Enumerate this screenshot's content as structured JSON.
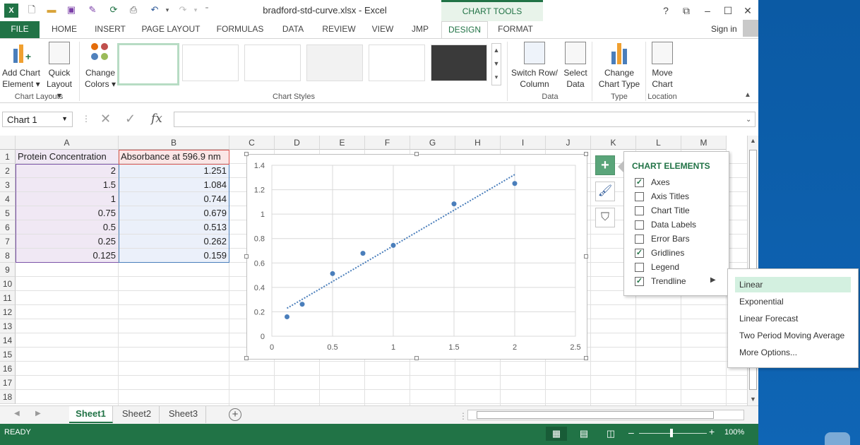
{
  "window": {
    "title": "bradford-std-curve.xlsx - Excel",
    "chart_tools": "CHART TOOLS",
    "help": "?",
    "sign_in": "Sign in"
  },
  "tabs": [
    "FILE",
    "HOME",
    "INSERT",
    "PAGE LAYOUT",
    "FORMULAS",
    "DATA",
    "REVIEW",
    "VIEW",
    "JMP",
    "DESIGN",
    "FORMAT"
  ],
  "ribbon": {
    "add_chart_1": "Add Chart",
    "add_chart_2": "Element ▾",
    "quick_layout_1": "Quick",
    "quick_layout_2": "Layout ▾",
    "change_colors_1": "Change",
    "change_colors_2": "Colors ▾",
    "switch_1": "Switch Row/",
    "switch_2": "Column",
    "select_1": "Select",
    "select_2": "Data",
    "change_type_1": "Change",
    "change_type_2": "Chart Type",
    "move_1": "Move",
    "move_2": "Chart",
    "groups": {
      "layouts": "Chart Layouts",
      "styles": "Chart Styles",
      "data": "Data",
      "type": "Type",
      "location": "Location"
    }
  },
  "formula_bar": {
    "name_box": "Chart 1",
    "fx": "fx",
    "value": ""
  },
  "columns": [
    "A",
    "B",
    "C",
    "D",
    "E",
    "F",
    "G",
    "H",
    "I",
    "J",
    "K",
    "L",
    "M"
  ],
  "rows": [
    "1",
    "2",
    "3",
    "4",
    "5",
    "6",
    "7",
    "8",
    "9",
    "10",
    "11",
    "12",
    "13",
    "14",
    "15",
    "16",
    "17",
    "18"
  ],
  "sheet": {
    "header_a": "Protein Concentration",
    "header_b": "Absorbance at 596.9 nm",
    "col_a": [
      "2",
      "1.5",
      "1",
      "0.75",
      "0.5",
      "0.25",
      "0.125"
    ],
    "col_b": [
      "1.251",
      "1.084",
      "0.744",
      "0.679",
      "0.513",
      "0.262",
      "0.159"
    ]
  },
  "chart_data": {
    "type": "scatter",
    "x": [
      2,
      1.5,
      1,
      0.75,
      0.5,
      0.25,
      0.125
    ],
    "y": [
      1.251,
      1.084,
      0.744,
      0.679,
      0.513,
      0.262,
      0.159
    ],
    "xlim": [
      0,
      2.5
    ],
    "ylim": [
      0,
      1.4
    ],
    "xticks": [
      "0",
      "0.5",
      "1",
      "1.5",
      "2",
      "2.5"
    ],
    "yticks": [
      "0",
      "0.2",
      "0.4",
      "0.6",
      "0.8",
      "1",
      "1.2",
      "1.4"
    ],
    "grid": true,
    "trendline": "linear",
    "trend_x": [
      0.125,
      2
    ],
    "trend_y": [
      0.229,
      1.324
    ],
    "marker_color": "#4a7ebb",
    "title": "",
    "xlabel": "",
    "ylabel": ""
  },
  "chart_elements": {
    "header": "CHART ELEMENTS",
    "items": [
      {
        "label": "Axes",
        "checked": true
      },
      {
        "label": "Axis Titles",
        "checked": false
      },
      {
        "label": "Chart Title",
        "checked": false
      },
      {
        "label": "Data Labels",
        "checked": false
      },
      {
        "label": "Error Bars",
        "checked": false
      },
      {
        "label": "Gridlines",
        "checked": true
      },
      {
        "label": "Legend",
        "checked": false
      },
      {
        "label": "Trendline",
        "checked": true
      }
    ]
  },
  "trendline_menu": [
    "Linear",
    "Exponential",
    "Linear Forecast",
    "Two Period Moving Average",
    "More Options..."
  ],
  "sheet_tabs": [
    "Sheet1",
    "Sheet2",
    "Sheet3"
  ],
  "status": {
    "ready": "READY",
    "zoom": "100%"
  },
  "colors": {
    "excel_green": "#217346",
    "selection_blue": "#4a7ebb"
  }
}
